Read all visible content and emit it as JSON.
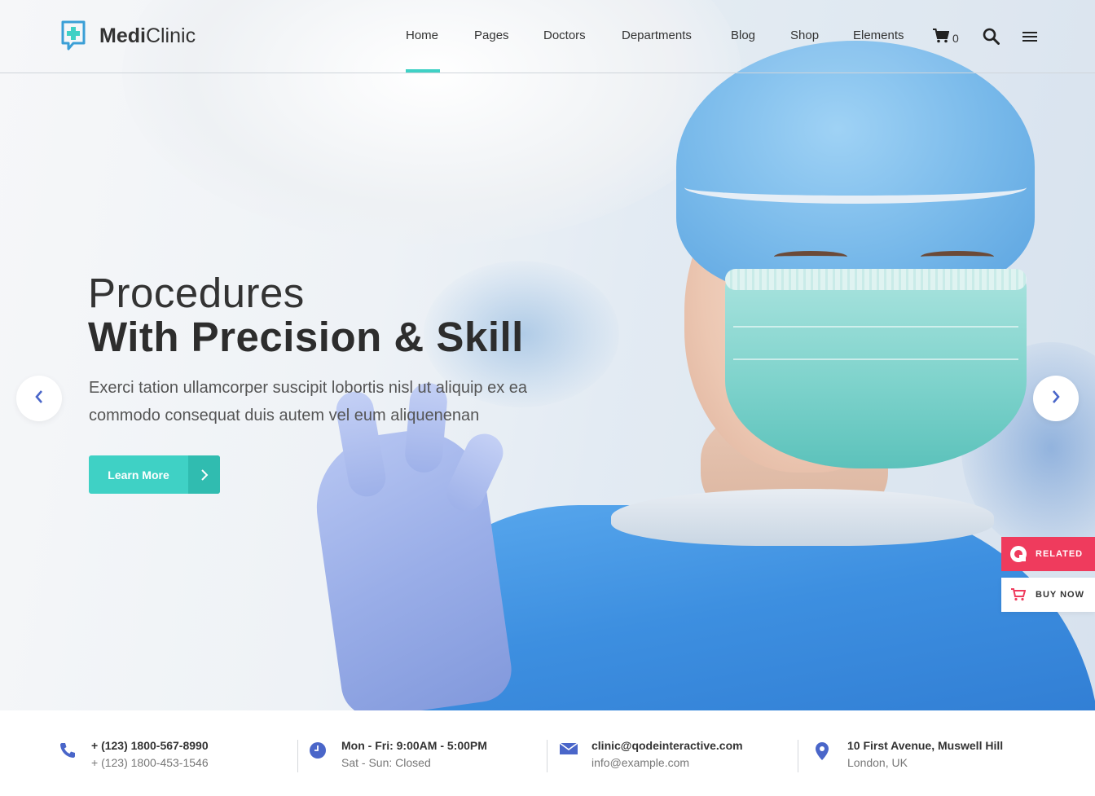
{
  "brand": {
    "name_bold": "Medi",
    "name_regular": "Clinic",
    "icon": "medical-cross-chat-icon",
    "accent": "#3fd1c5",
    "icon_color": "#3a9fd6"
  },
  "nav": {
    "items": [
      {
        "label": "Home",
        "active": true
      },
      {
        "label": "Pages"
      },
      {
        "label": "Doctors"
      },
      {
        "label": "Departments"
      },
      {
        "label": "Blog"
      },
      {
        "label": "Shop"
      },
      {
        "label": "Elements"
      }
    ],
    "cart_count": "0",
    "cart_icon": "cart-icon",
    "search_icon": "search-icon",
    "menu_icon": "hamburger-menu-icon"
  },
  "slide": {
    "title_line1": "Procedures",
    "title_line2": "With Precision & Skill",
    "text": "Exerci tation ullamcorper suscipit lobortis nisl ut aliquip ex ea commodo consequat duis autem vel eum aliquenenan",
    "button_label": "Learn More",
    "prev_icon": "chevron-left-icon",
    "next_icon": "chevron-right-icon"
  },
  "side_widgets": {
    "related_label": "RELATED",
    "buy_label": "BUY NOW",
    "related_color": "#ef3b5d",
    "buy_icon_color": "#ef3b5d"
  },
  "info": [
    {
      "icon": "phone-icon",
      "main": "+ (123) 1800-567-8990",
      "sub": "+ (123) 1800-453-1546"
    },
    {
      "icon": "clock-icon",
      "main": "Mon - Fri: 9:00AM - 5:00PM",
      "sub": "Sat - Sun: Closed"
    },
    {
      "icon": "envelope-icon",
      "main": "clinic@qodeinteractive.com",
      "sub": "info@example.com"
    },
    {
      "icon": "location-pin-icon",
      "main": "10 First Avenue, Muswell Hill",
      "sub": "London, UK"
    }
  ],
  "info_icon_color": "#4a66c9"
}
